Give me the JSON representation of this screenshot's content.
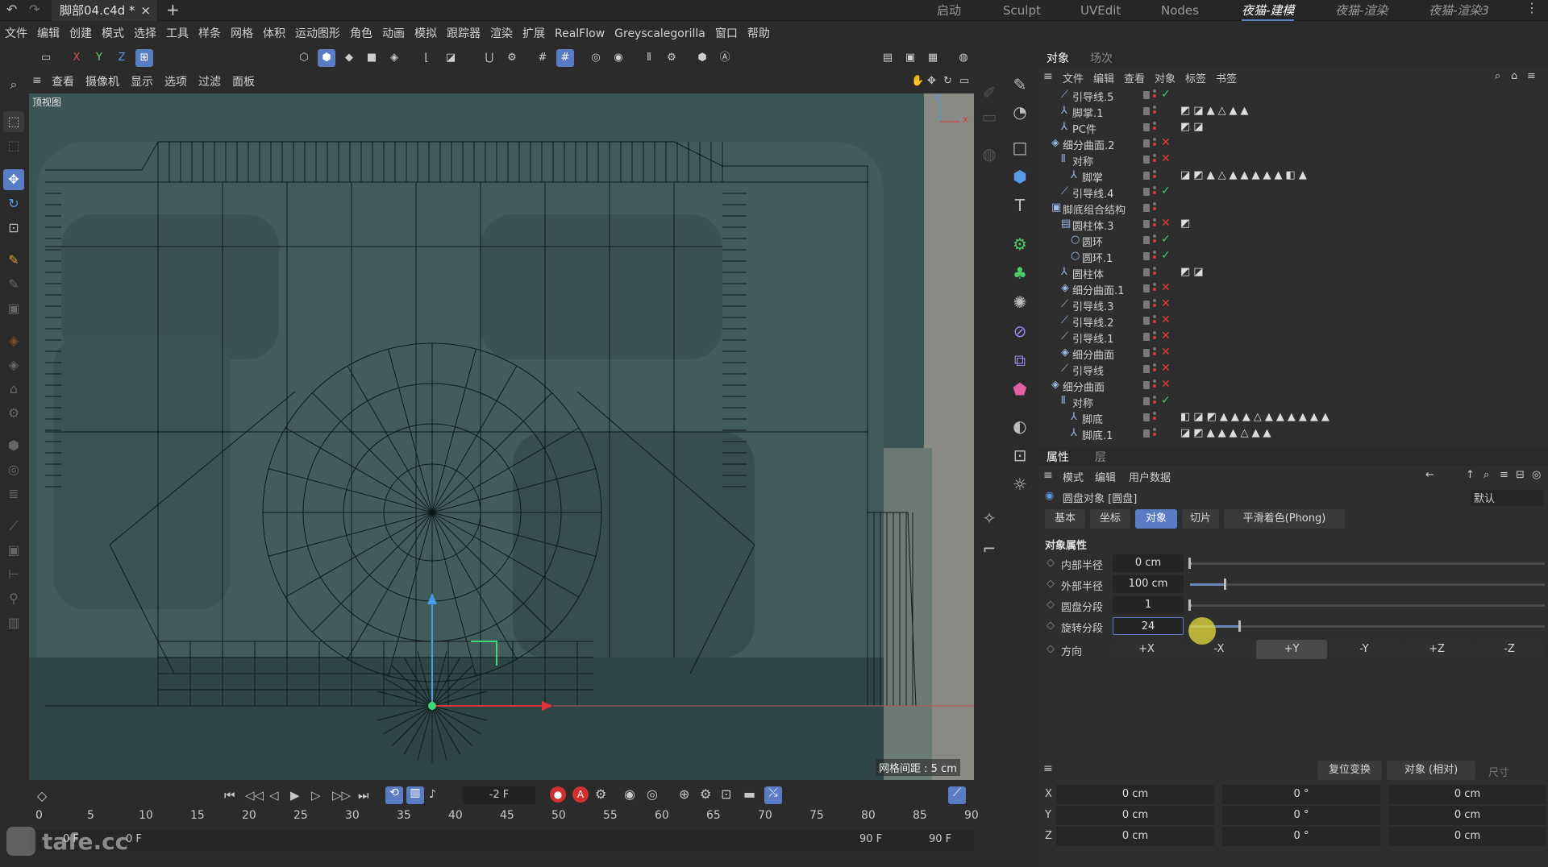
{
  "file_tab": "脚部04.c4d *",
  "layouts": [
    "启动",
    "Sculpt",
    "UVEdit",
    "Nodes",
    "夜猫-建模",
    "夜猫-渲染",
    "夜猫-渲染3"
  ],
  "active_layout_index": 4,
  "menu": [
    "文件",
    "编辑",
    "创建",
    "模式",
    "选择",
    "工具",
    "样条",
    "网格",
    "体积",
    "运动图形",
    "角色",
    "动画",
    "模拟",
    "跟踪器",
    "渲染",
    "扩展",
    "RealFlow",
    "Greyscalegorilla",
    "窗口",
    "帮助"
  ],
  "axis_buttons": [
    "X",
    "Y",
    "Z"
  ],
  "viewport_menu": [
    "查看",
    "摄像机",
    "显示",
    "选项",
    "过滤",
    "面板"
  ],
  "viewport_label": "顶视图",
  "grid_spacing": "网格间距 : 5 cm",
  "panel_tabs": [
    "对象",
    "场次"
  ],
  "panel_menu": [
    "文件",
    "编辑",
    "查看",
    "对象",
    "标签",
    "书签"
  ],
  "objects": [
    {
      "name": "引导线.5",
      "icon": "⟋",
      "indent": 1,
      "status": "✓",
      "tags": ""
    },
    {
      "name": "脚掌.1",
      "icon": "⅄",
      "indent": 1,
      "status": "",
      "tags": "◩◪▲△▲▲"
    },
    {
      "name": "PC件",
      "icon": "⅄",
      "indent": 1,
      "status": "",
      "tags": "◩◪"
    },
    {
      "name": "细分曲面.2",
      "icon": "◈",
      "indent": 0,
      "status": "✕",
      "tags": ""
    },
    {
      "name": "对称",
      "icon": "⫴",
      "indent": 1,
      "status": "✕",
      "tags": ""
    },
    {
      "name": "脚掌",
      "icon": "⅄",
      "indent": 2,
      "status": "",
      "tags": "◪◩▲△▲▲▲▲▲◧▲"
    },
    {
      "name": "引导线.4",
      "icon": "⟋",
      "indent": 1,
      "status": "✓",
      "tags": ""
    },
    {
      "name": "脚底组合结构",
      "icon": "▣",
      "indent": 0,
      "status": "",
      "tags": ""
    },
    {
      "name": "圆柱体.3",
      "icon": "▤",
      "indent": 1,
      "status": "✕",
      "tags": "◩"
    },
    {
      "name": "圆环",
      "icon": "○",
      "indent": 2,
      "status": "✓",
      "tags": ""
    },
    {
      "name": "圆环.1",
      "icon": "○",
      "indent": 2,
      "status": "✓",
      "tags": ""
    },
    {
      "name": "圆柱体",
      "icon": "⅄",
      "indent": 1,
      "status": "",
      "tags": "◩◪"
    },
    {
      "name": "细分曲面.1",
      "icon": "◈",
      "indent": 1,
      "status": "✕",
      "tags": ""
    },
    {
      "name": "引导线.3",
      "icon": "⟋",
      "indent": 1,
      "status": "✕",
      "tags": ""
    },
    {
      "name": "引导线.2",
      "icon": "⟋",
      "indent": 1,
      "status": "✕",
      "tags": ""
    },
    {
      "name": "引导线.1",
      "icon": "⟋",
      "indent": 1,
      "status": "✕",
      "tags": ""
    },
    {
      "name": "细分曲面",
      "icon": "◈",
      "indent": 1,
      "status": "✕",
      "tags": ""
    },
    {
      "name": "引导线",
      "icon": "⟋",
      "indent": 1,
      "status": "✕",
      "tags": ""
    },
    {
      "name": "细分曲面",
      "icon": "◈",
      "indent": 0,
      "status": "✕",
      "tags": ""
    },
    {
      "name": "对称",
      "icon": "⫴",
      "indent": 1,
      "status": "✓",
      "tags": ""
    },
    {
      "name": "脚底",
      "icon": "⅄",
      "indent": 2,
      "status": "",
      "tags": "◧◪◩▲▲▲△▲▲▲▲▲▲"
    },
    {
      "name": "脚底.1",
      "icon": "⅄",
      "indent": 2,
      "status": "",
      "tags": "◪◩▲▲▲△▲▲"
    }
  ],
  "attr": {
    "tabs": [
      "属性",
      "层"
    ],
    "menu": [
      "模式",
      "编辑",
      "用户数据"
    ],
    "object_title": "圆盘对象 [圆盘]",
    "preset": "默认",
    "subtabs": [
      "基本",
      "坐标",
      "对象",
      "切片",
      "平滑着色(Phong)"
    ],
    "section": "对象属性",
    "params": [
      {
        "label": "内部半径",
        "value": "0 cm",
        "fill": 0.0
      },
      {
        "label": "外部半径",
        "value": "100 cm",
        "fill": 0.1
      },
      {
        "label": "圆盘分段",
        "value": "1",
        "fill": 0.0
      },
      {
        "label": "旋转分段",
        "value": "24",
        "fill": 0.14
      }
    ],
    "direction_label": "方向",
    "directions": [
      "+X",
      "-X",
      "+Y",
      "-Y",
      "+Z",
      "-Z"
    ],
    "direction_selected": "+Y"
  },
  "coords": {
    "reset_btn": "复位变换",
    "mode": "对象 (相对)",
    "size_label": "尺寸",
    "rows": [
      {
        "axis": "X",
        "pos": "0 cm",
        "rot": "0 °",
        "size": "0 cm"
      },
      {
        "axis": "Y",
        "pos": "0 cm",
        "rot": "0 °",
        "size": "0 cm"
      },
      {
        "axis": "Z",
        "pos": "0 cm",
        "rot": "0 °",
        "size": "0 cm"
      }
    ]
  },
  "timeline": {
    "current_frame": "-2 F",
    "ticks": [
      "0",
      "5",
      "10",
      "15",
      "20",
      "25",
      "30",
      "35",
      "40",
      "45",
      "50",
      "55",
      "60",
      "65",
      "70",
      "75",
      "80",
      "85",
      "90"
    ],
    "start_a": "0 F",
    "start_b": "0 F",
    "end_a": "90 F",
    "end_b": "90 F"
  },
  "watermark": "tafe.cc",
  "colors": {
    "accent": "#5a7cc4",
    "viewport_bg": "#3d5656",
    "x_axis": "#e0303a",
    "y_axis": "#4a9be8",
    "z_axis": "#3fd97a"
  }
}
